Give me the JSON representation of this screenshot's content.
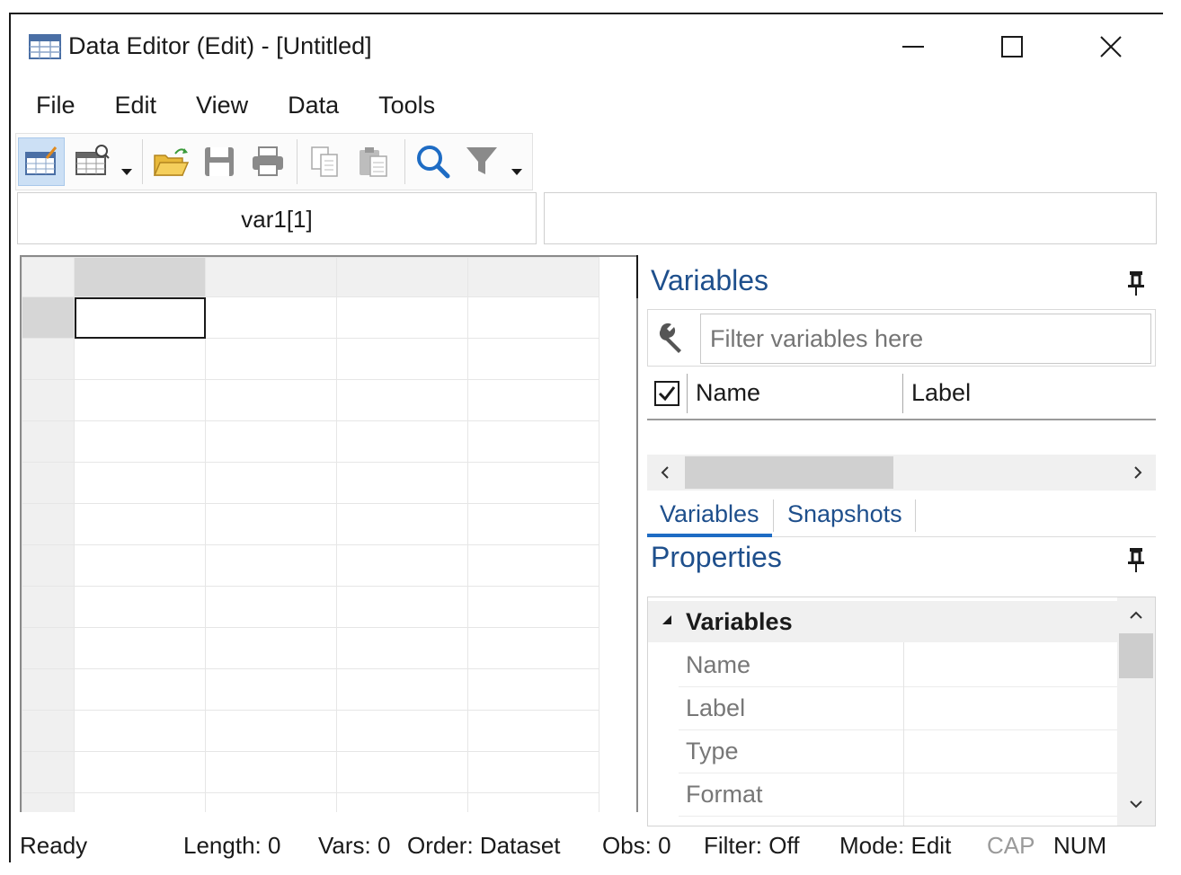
{
  "window": {
    "title": "Data Editor (Edit) - [Untitled]"
  },
  "menu": [
    "File",
    "Edit",
    "View",
    "Data",
    "Tools"
  ],
  "toolbar": {
    "icons": [
      "data-editor-edit-icon",
      "data-editor-browse-icon",
      "open-folder-icon",
      "save-icon",
      "print-icon",
      "copy-icon",
      "paste-icon",
      "search-icon",
      "filter-icon"
    ]
  },
  "cell_reference": "var1[1]",
  "cell_value": "",
  "variables_panel": {
    "title": "Variables",
    "filter_placeholder": "Filter variables here",
    "columns": [
      "Name",
      "Label"
    ],
    "tabs": [
      "Variables",
      "Snapshots"
    ],
    "active_tab": "Variables"
  },
  "properties_panel": {
    "title": "Properties",
    "category": "Variables",
    "rows": [
      "Name",
      "Label",
      "Type",
      "Format"
    ]
  },
  "status": {
    "ready": "Ready",
    "length": "Length: 0",
    "vars": "Vars: 0",
    "order": "Order: Dataset",
    "obs": "Obs: 0",
    "filter": "Filter: Off",
    "mode": "Mode: Edit",
    "cap": "CAP",
    "num": "NUM"
  },
  "colors": {
    "accent_blue": "#1e4f8c",
    "tab_underline": "#1e6cc4",
    "selection": "#cce0f5"
  }
}
